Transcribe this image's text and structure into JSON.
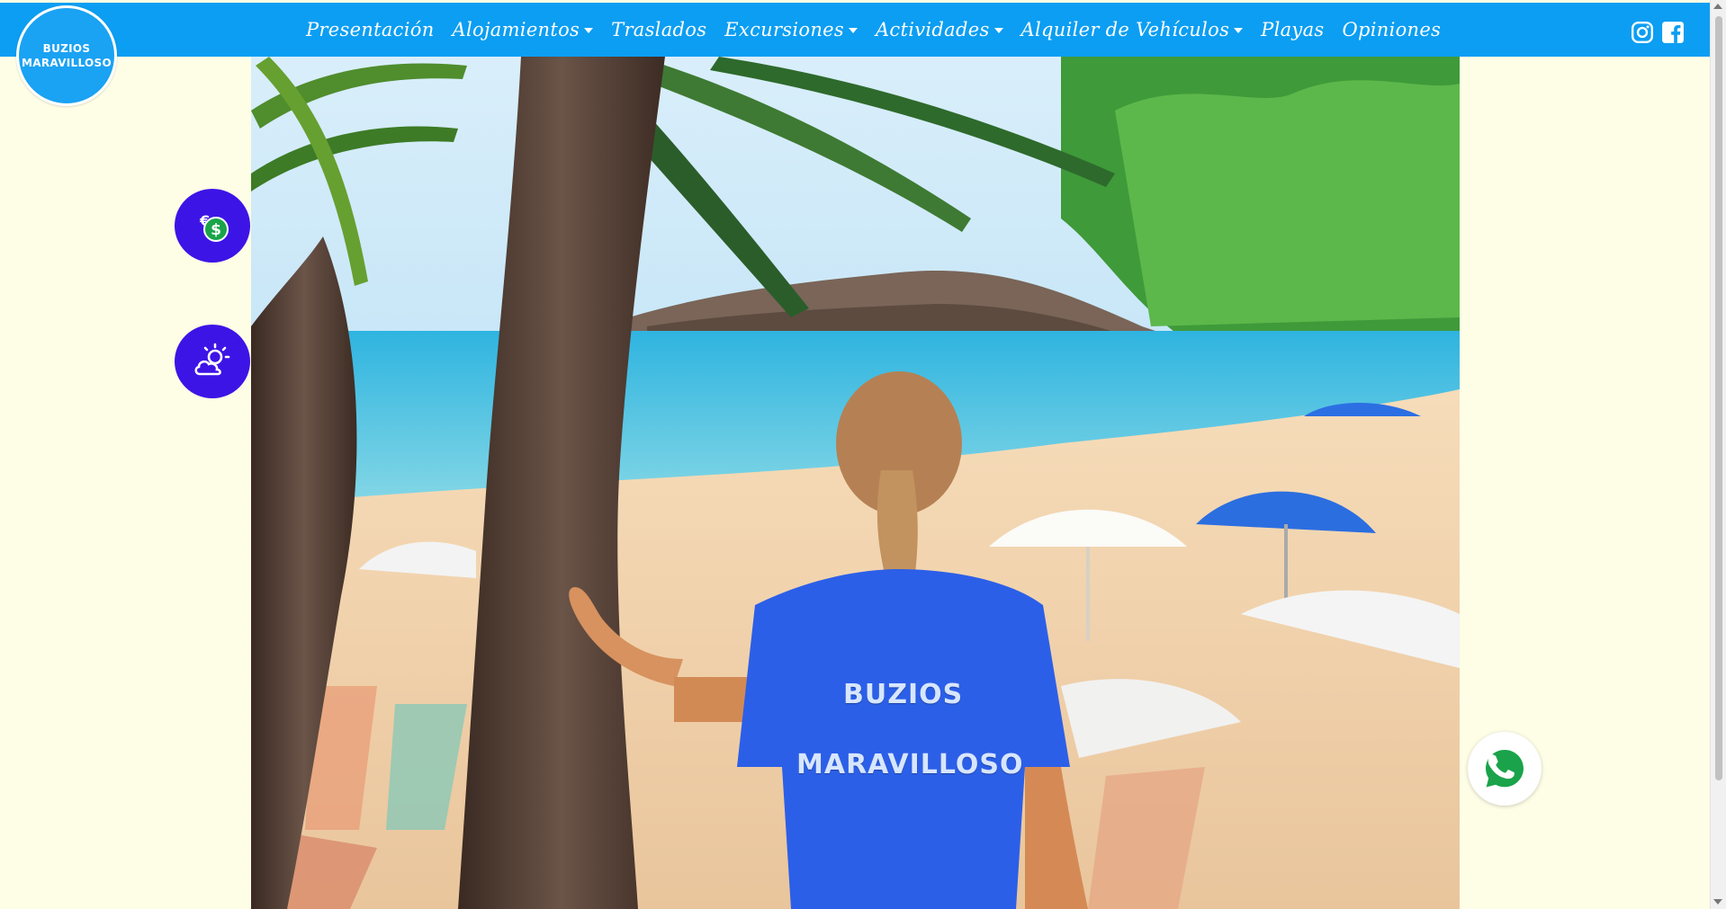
{
  "brand": {
    "logo_line1": "BUZIOS",
    "logo_line2": "MARAVILLOSO"
  },
  "nav": [
    {
      "label": "Presentación",
      "dropdown": false
    },
    {
      "label": "Alojamientos",
      "dropdown": true
    },
    {
      "label": "Traslados",
      "dropdown": false
    },
    {
      "label": "Excursiones",
      "dropdown": true
    },
    {
      "label": "Actividades",
      "dropdown": true
    },
    {
      "label": "Alquiler de Vehículos",
      "dropdown": true
    },
    {
      "label": "Playas",
      "dropdown": false
    },
    {
      "label": "Opiniones",
      "dropdown": false
    }
  ],
  "social": {
    "icons": [
      "instagram-icon",
      "facebook-icon"
    ]
  },
  "floating_buttons": {
    "currency_icon": "currency-exchange-icon",
    "currency_symbol": "$",
    "weather_icon": "weather-icon",
    "whatsapp_icon": "whatsapp-icon"
  },
  "hero": {
    "shirt_line1": "BUZIOS",
    "shirt_line2": "MARAVILLOSO"
  },
  "colors": {
    "nav_background": "#0c9ef2",
    "page_background": "#fefde6",
    "floating_button": "#3d14e6",
    "whatsapp_green": "#1aa34a"
  }
}
